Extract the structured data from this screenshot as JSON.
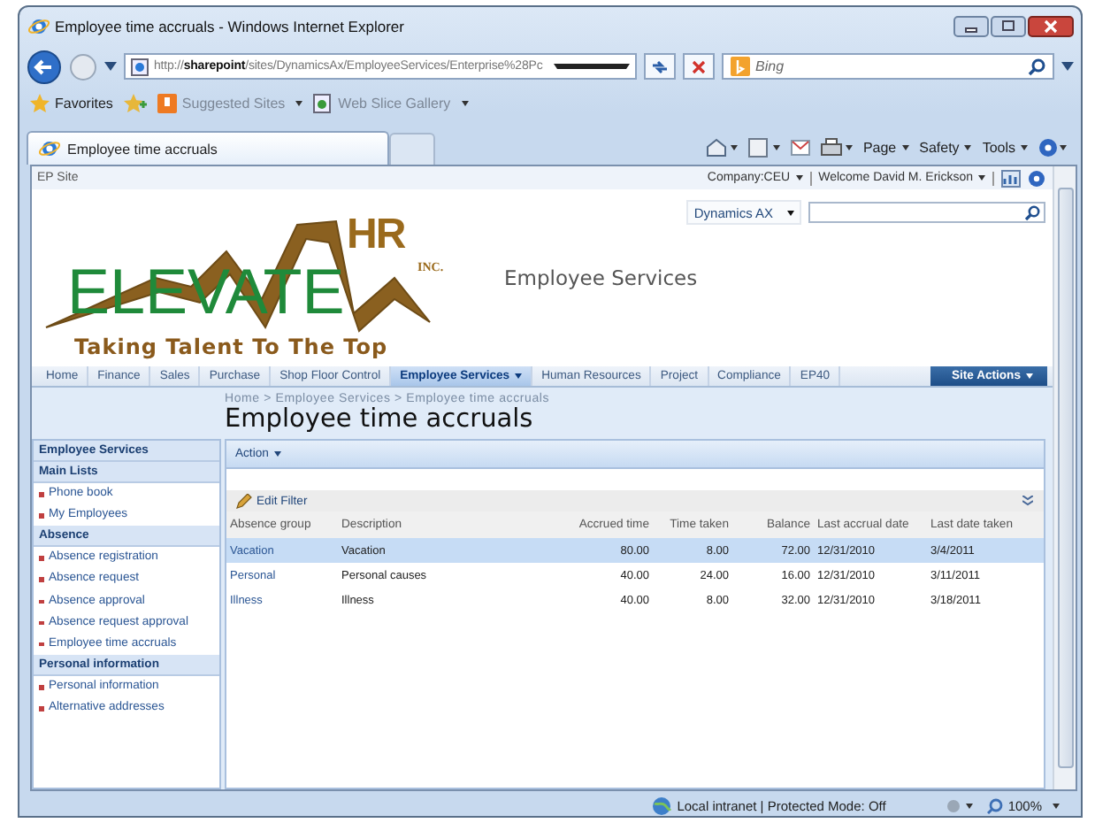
{
  "window": {
    "title": "Employee time accruals - Windows Internet Explorer"
  },
  "address_bar": {
    "url": "http://**sharepoint**/sites/DynamicsAx/EmployeeServices/Enterprise%28Pc",
    "search_placeholder": "Bing"
  },
  "favorites_bar": {
    "favorites": "Favorites",
    "links": [
      "Suggested Sites",
      "Web Slice Gallery"
    ]
  },
  "tabs": [
    {
      "label": "Employee time accruals",
      "selected": true
    }
  ],
  "command_bar": [
    "Page",
    "Safety",
    "Tools"
  ],
  "site_bar": {
    "site": "EP Site",
    "company": "Company:CEU",
    "welcome": "Welcome David M. Erickson"
  },
  "header": {
    "search_scope": "Dynamics AX",
    "logo": {
      "mark": "HR",
      "name": "ELEVATE",
      "suffix": "INC.",
      "tagline": "Taking Talent To The Top"
    },
    "site_title": "Employee Services"
  },
  "top_nav": [
    {
      "label": "Home",
      "selected": false
    },
    {
      "label": "Finance",
      "selected": false
    },
    {
      "label": "Sales",
      "selected": false
    },
    {
      "label": "Purchase",
      "selected": false
    },
    {
      "label": "Shop Floor Control",
      "selected": false
    },
    {
      "label": "Employee Services",
      "selected": true
    },
    {
      "label": "Human Resources",
      "selected": false
    },
    {
      "label": "Project",
      "selected": false
    },
    {
      "label": "Compliance",
      "selected": false
    },
    {
      "label": "EP40",
      "selected": false
    }
  ],
  "site_actions": "Site Actions",
  "breadcrumb": "Home > Employee Services > Employee time accruals",
  "page_title": "Employee time accruals",
  "sidebar": {
    "title": "Employee Services",
    "sections": [
      {
        "heading": "Main Lists",
        "items": [
          "Phone book",
          "My Employees"
        ]
      },
      {
        "heading": "Absence",
        "items": [
          "Absence registration",
          "Absence request",
          "Absence approval",
          "Absence request approval",
          "Employee time accruals"
        ]
      },
      {
        "heading": "Personal information",
        "items": [
          "Personal information",
          "Alternative addresses"
        ]
      }
    ]
  },
  "action_menu": "Action",
  "edit_filter": "Edit Filter",
  "table": {
    "columns": [
      "Absence group",
      "Description",
      "Accrued time",
      "Time taken",
      "Balance",
      "Last accrual date",
      "Last date taken"
    ],
    "rows": [
      {
        "cells": [
          "Vacation",
          "Vacation",
          "80.00",
          "8.00",
          "72.00",
          "12/31/2010",
          "3/4/2011"
        ],
        "selected": true
      },
      {
        "cells": [
          "Personal",
          "Personal causes",
          "40.00",
          "24.00",
          "16.00",
          "12/31/2010",
          "3/11/2011"
        ],
        "selected": false
      },
      {
        "cells": [
          "Illness",
          "Illness",
          "40.00",
          "8.00",
          "32.00",
          "12/31/2010",
          "3/18/2011"
        ],
        "selected": false
      }
    ]
  },
  "status_bar": {
    "zone": "Local intranet | Protected Mode: Off",
    "zoom": "100%"
  }
}
